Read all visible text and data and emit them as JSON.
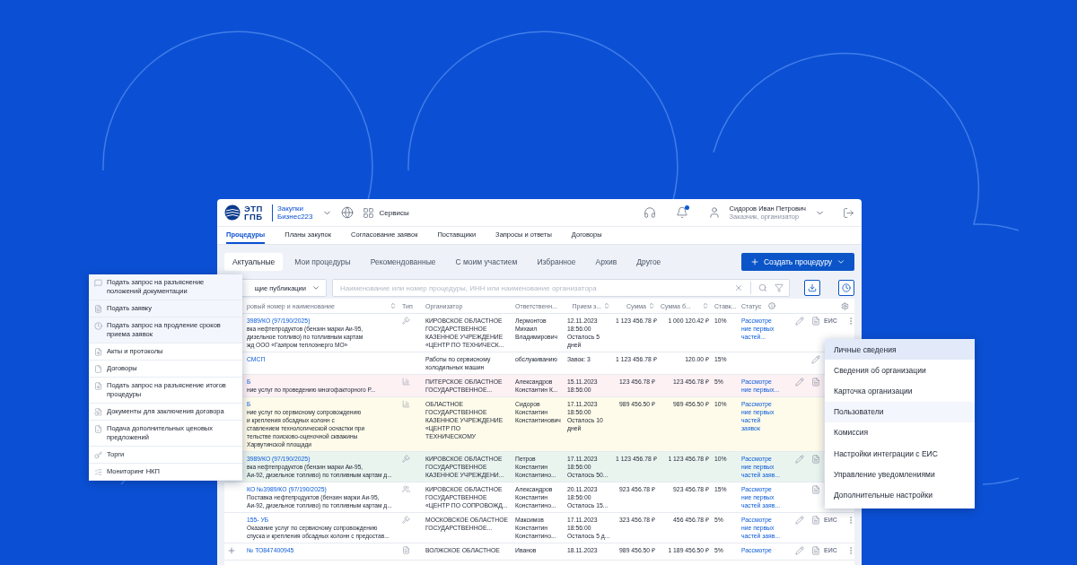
{
  "header": {
    "logo_lines": [
      "ЭТП",
      "ГПБ"
    ],
    "product_lines": [
      "Закупки",
      "Бизнес223"
    ],
    "services": "Сервисы",
    "notification_dot": true,
    "user_name": "Сидоров Иван Петрович",
    "user_role": "Заказчик, организатор"
  },
  "nav_tabs": [
    {
      "label": "Процедуры",
      "selected": true
    },
    {
      "label": "Планы закупок",
      "selected": false
    },
    {
      "label": "Согласование заявок",
      "selected": false
    },
    {
      "label": "Поставщики",
      "selected": false
    },
    {
      "label": "Запросы и ответы",
      "selected": false
    },
    {
      "label": "Договоры",
      "selected": false
    }
  ],
  "sub_tabs": [
    {
      "label": "Актуальные",
      "selected": true
    },
    {
      "label": "Мои процедуры",
      "selected": false
    },
    {
      "label": "Рекомендованные",
      "selected": false
    },
    {
      "label": "С моим участием",
      "selected": false
    },
    {
      "label": "Избранное",
      "selected": false
    },
    {
      "label": "Архив",
      "selected": false
    },
    {
      "label": "Другое",
      "selected": false
    }
  ],
  "create_button": "Создать процедуру",
  "filter": {
    "dropdown": "щие публикации",
    "search_placeholder": "Наименование или номер процедуры, ИНН или наименование организатора"
  },
  "table": {
    "columns": [
      {
        "label": "ровый номер и наименование",
        "kind": "sortable"
      },
      {
        "label": "Тип",
        "kind": "plain"
      },
      {
        "label": "Организатор",
        "kind": "plain"
      },
      {
        "label": "Ответственн...",
        "kind": "plain"
      },
      {
        "label": "Прием з...",
        "kind": "sortable"
      },
      {
        "label": "Сумма",
        "kind": "sortable"
      },
      {
        "label": "Сумма б...",
        "kind": "sortable"
      },
      {
        "label": "Ставк...",
        "kind": "plain"
      },
      {
        "label": "Статус",
        "kind": "info"
      },
      {
        "kind": "settings"
      }
    ],
    "rows": [
      {
        "color": "#ffffff",
        "number": "3989/КО (97/190/2025)",
        "desc_lines": [
          "вка нефтепродуктов (бензин марки Аи-95,",
          "дизельное топливо) по топливным картам",
          "жд ООО «Газпром теплоэнерго МО»"
        ],
        "kind": "auction",
        "organizer": "КИРОВСКОЕ ОБЛАСТНОЕ ГОСУДАРСТВЕННОЕ КАЗЕННОЕ УЧРЕЖДЕНИЕ «ЦЕНТР ПО ТЕХНИЧЕСК...",
        "responsible": "Лермонтов Михаил Владимирович",
        "deadline": "12.11.2023 18:56:00 Осталось 5 дней",
        "sum": "1 123 456.78 ₽",
        "sum2": "1 000 120.42 ₽",
        "rate": "10%",
        "status": "Рассмотре ние первых частей...",
        "actions": [
          {
            "kind": "edit"
          },
          {
            "kind": "doc"
          },
          {
            "kind": "eis",
            "label": "ЕИС"
          },
          {
            "kind": "more"
          }
        ]
      },
      {
        "color": "#ffffff",
        "number": "СМСП",
        "desc_lines": [],
        "kind": "plain",
        "organizer": "Работы по сервисному холодильных машин",
        "responsible": "обслуживанию",
        "deadline": "Завок: 3",
        "sum": "1 123 456.78 ₽",
        "sum2": "120.00 ₽",
        "rate": "15%",
        "actions": [
          {
            "kind": "edit"
          }
        ]
      },
      {
        "color": "#fdf1f4",
        "number": "Б",
        "desc_lines": [
          "ние услуг по проведению многофакторного Р..."
        ],
        "kind": "chart",
        "organizer": "ПИТЕРСКОЕ ОБЛАСТНОЕ ГОСУДАРСТВЕННОЕ...",
        "responsible": "Александров Константин К...",
        "deadline": "15.11.2023 18:56:00",
        "sum": "123 456.78 ₽",
        "sum2": "123 456.78 ₽",
        "rate": "5%",
        "status": "Рассмотре ние первых...",
        "actions": [
          {
            "kind": "edit"
          },
          {
            "kind": "doc"
          }
        ]
      },
      {
        "color": "#fefbea",
        "number": "Б",
        "desc_lines": [
          "ние услуг по сервисному сопровождению",
          "и крепления обсадных колонн с",
          "ставлением технологической оснастки при",
          "тельстве поисково-оценочной скважины",
          "Харвутинской площади"
        ],
        "kind": "chart",
        "organizer": "ОБЛАСТНОЕ ГОСУДАРСТВЕННОЕ КАЗЕННОЕ УЧРЕЖДЕНИЕ «ЦЕНТР ПО ТЕХНИЧЕСКОМУ",
        "responsible": "Сидоров Константин Константинович",
        "deadline": "17.11.2023 18:56:00 Осталось 10 дней",
        "sum": "989 456.50 ₽",
        "sum2": "989 456.50 ₽",
        "rate": "10%",
        "status": "Рассмотре ние первых частей заявок",
        "actions": []
      },
      {
        "color": "#eaf4ef",
        "number": "3989/КО (97/190/2025)",
        "desc_lines": [
          "вка нефтепродуктов (бензин марки Аи-95,",
          "Аи-92, дизельное топливо) по топливным картам д..."
        ],
        "kind": "auction",
        "organizer": "КИРОВСКОЕ ОБЛАСТНОЕ ГОСУДАРСТВЕННОЕ КАЗЕННОЕ УЧРЕЖДЕНИ...",
        "responsible": "Петров Константин Константино...",
        "deadline": "17.11.2023 18:56:00 Осталось 50...",
        "sum": "1 123 456.78 ₽",
        "sum2": "1 123 456.78 ₽",
        "rate": "10%",
        "status": "Рассмотре ние первых частей заяв...",
        "actions": [
          {
            "kind": "edit"
          },
          {
            "kind": "doc"
          }
        ]
      },
      {
        "color": "#ffffff",
        "number": "КО №3989/КО (97/190/2025)",
        "desc_lines": [
          "Поставка нефтепродуктов (бензин марки Аи-95,",
          "Аи-92, дизельное топливо) по топливным картам д..."
        ],
        "kind": "people",
        "organizer": "КИРОВСКОЕ ОБЛАСТНОЕ ГОСУДАРСТВЕННОЕ «ЦЕНТР ПО СОПРОВОЖД...",
        "responsible": "Александров Константин Константино...",
        "deadline": "20.11.2023 18:56:00 Осталось 15...",
        "sum": "923 456.78 ₽",
        "sum2": "923 456.78 ₽",
        "rate": "15%",
        "status": "Рассмотре ние первых частей заяв...",
        "actions": [
          {
            "kind": "doc"
          }
        ]
      },
      {
        "color": "#ffffff",
        "number": "155- УБ",
        "desc_lines": [
          "Оказание услуг по сервисному сопровождению",
          "спуска и крепления обсадных колонн с предостав..."
        ],
        "kind": "auction",
        "organizer": "МОСКОВСКОЕ ОБЛАСТНОЕ ГОСУДАРСТВЕННОЕ...",
        "responsible": "Максимов Константин Константино...",
        "deadline": "17.11.2023 18:56:00 Осталось 5 д...",
        "sum": "323 456.78 ₽",
        "sum2": "456 456.78 ₽",
        "rate": "5%",
        "status": "Рассмотре ние первых частей заяв...",
        "actions": [
          {
            "kind": "edit"
          },
          {
            "kind": "doc"
          },
          {
            "kind": "eis",
            "label": "ЕИС"
          },
          {
            "kind": "more"
          }
        ]
      },
      {
        "color": "#ffffff",
        "expandable": true,
        "number": "№ ТО847400945",
        "desc_lines": [],
        "kind": "doc",
        "organizer": "ВОЛЖСКОЕ ОБЛАСТНОЕ",
        "responsible": "Иванов",
        "deadline": "18.11.2023",
        "sum": "989 456.50 ₽",
        "sum2": "1 189 456.50 ₽",
        "rate": "5%",
        "status": "Рассмотре",
        "actions": [
          {
            "kind": "edit"
          },
          {
            "kind": "doc"
          },
          {
            "kind": "eis",
            "label": "ЕИС"
          },
          {
            "kind": "more"
          }
        ]
      }
    ]
  },
  "actions_menu": [
    {
      "label": "Подать запрос на разъяснение положений документации",
      "highlighted": true
    },
    {
      "label": "Подать заявку",
      "highlighted": true
    },
    {
      "label": "Подать запрос на продление сроков приема заявок",
      "highlighted": true
    },
    {
      "label": "Акты и протоколы",
      "highlighted": false
    },
    {
      "label": "Договоры",
      "highlighted": false
    },
    {
      "label": "Подать запрос на разъяснение итогов процедуры",
      "highlighted": false
    },
    {
      "label": "Документы для заключения договора",
      "highlighted": false
    },
    {
      "label": "Подача дополнительных ценовых предложений",
      "highlighted": false
    },
    {
      "label": "Торги",
      "highlighted": false
    },
    {
      "label": "Мониторинг НКП",
      "highlighted": false
    }
  ],
  "profile_menu": [
    {
      "label": "Личные сведения",
      "selected": true,
      "hovered": false
    },
    {
      "label": "Сведения об организации",
      "selected": false,
      "hovered": false
    },
    {
      "label": "Карточка организации",
      "selected": false,
      "hovered": false
    },
    {
      "label": "Пользователи",
      "selected": false,
      "hovered": true
    },
    {
      "label": "Комиссия",
      "selected": false,
      "hovered": false
    },
    {
      "label": "Настройки интеграции с ЕИС",
      "selected": false,
      "hovered": false
    },
    {
      "label": "Управление уведомлениями",
      "selected": false,
      "hovered": false
    },
    {
      "label": "Дополнительные настройки",
      "selected": false,
      "hovered": false
    }
  ]
}
